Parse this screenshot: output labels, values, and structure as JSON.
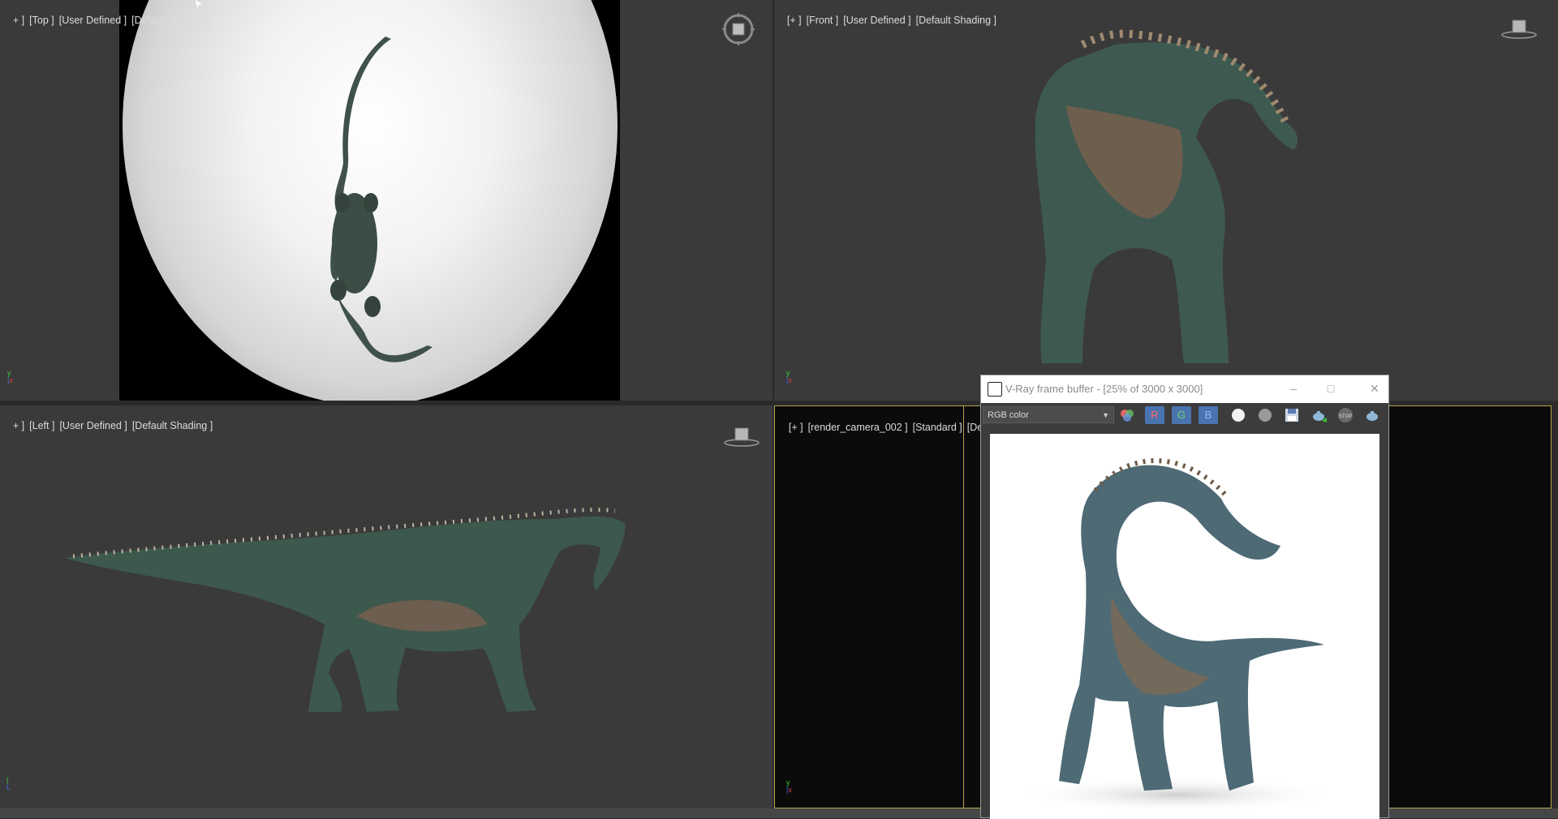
{
  "viewports": {
    "top": {
      "labels": [
        "+ ]",
        "[Top ]",
        "[User Defined ]",
        "[Default Shading ]"
      ]
    },
    "front": {
      "labels": [
        "[+ ]",
        "[Front ]",
        "[User Defined ]",
        "[Default Shading ]"
      ]
    },
    "left": {
      "labels": [
        "+ ]",
        "[Left ]",
        "[User Defined ]",
        "[Default Shading ]"
      ]
    },
    "camera": {
      "labels": [
        "[+ ]",
        "[render_camera_002 ]",
        "[Standard ]",
        "[Defau"
      ]
    }
  },
  "axis_gizmo": {
    "y": "y",
    "x": "x",
    "z": "z"
  },
  "vfb": {
    "title": "V-Ray frame buffer - [25% of 3000 x 3000]",
    "channel_select": "RGB color",
    "buttons": {
      "r": "R",
      "g": "G",
      "b": "B"
    },
    "window_controls": {
      "minimize": "–",
      "maximize": "□",
      "close": "✕"
    }
  },
  "colors": {
    "viewport_bg": "#3a3a3a",
    "active_border": "#b8a24a",
    "rgb_button": "#4a74b0",
    "creature_green": "#3f5e52",
    "creature_belly": "#7b6a55"
  },
  "icons": [
    "nav-cube-icon",
    "view-cube-icon",
    "axis-tripod-icon",
    "vray-logo-icon",
    "channels-icon",
    "white-sphere-icon",
    "grey-sphere-icon",
    "save-icon",
    "teapot-render-icon",
    "stop-icon",
    "teapot-region-icon"
  ]
}
